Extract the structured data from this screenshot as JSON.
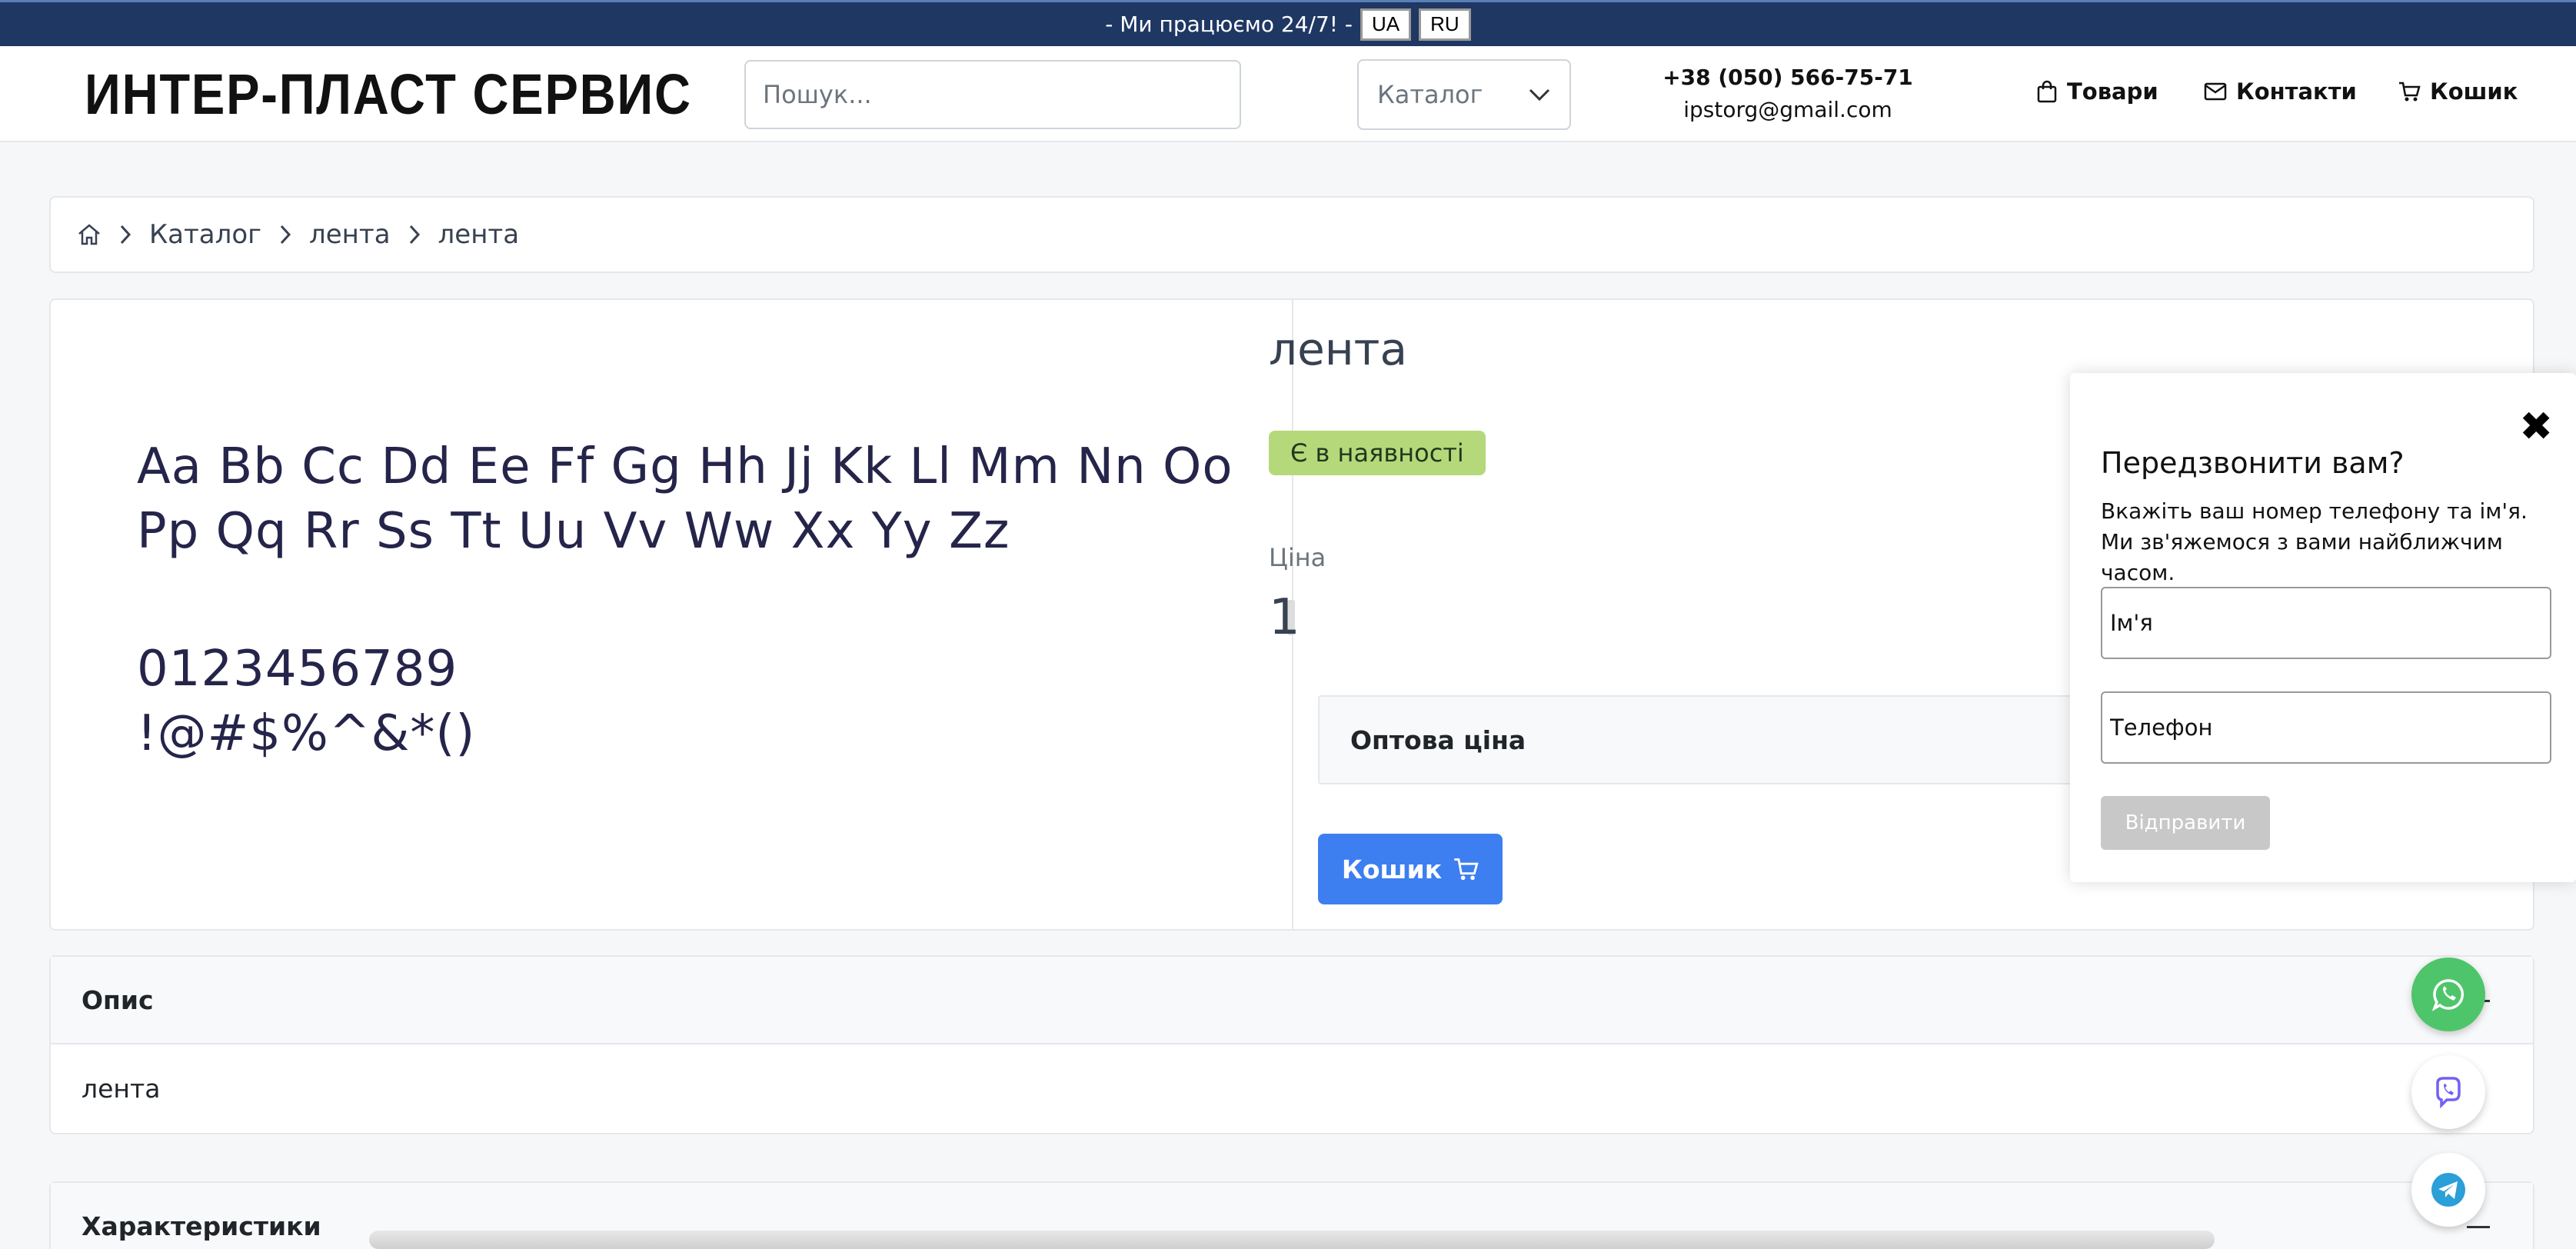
{
  "topbar": {
    "message": "- Ми працюємо 24/7! -",
    "lang_ua": "UA",
    "lang_ru": "RU"
  },
  "header": {
    "logo": "ИНТЕР-ПЛАСТ СЕРВИС",
    "search_placeholder": "Пошук...",
    "catalog_select": "Каталог",
    "phone": "+38 (050) 566-75-71",
    "email": "ipstorg@gmail.com",
    "nav": {
      "products": "Товари",
      "contacts": "Контакти",
      "cart": "Кошик"
    }
  },
  "breadcrumb": {
    "items": [
      "Каталог",
      "лента",
      "лента"
    ]
  },
  "product": {
    "specimen": {
      "line1": "Aa Bb Cc Dd Ee Ff Gg Hh Jj Kk Ll Mm Nn Oo",
      "line2": "Pp Qq Rr Ss Tt Uu Vv Ww Xx Yy Zz",
      "line3": "0123456789",
      "line4": "!@#$%^&*()"
    },
    "title": "лента",
    "stock_badge": "Є в наявності",
    "price_label": "Ціна",
    "price_value": "1",
    "wholesale_label": "Оптова ціна",
    "cart_button": "Кошик"
  },
  "description": {
    "title": "Опис",
    "text": "лента"
  },
  "specs": {
    "title": "Характеристики"
  },
  "callback": {
    "title": "Передзвонити вам?",
    "line1": "Вкажіть ваш номер телефону та ім'я.",
    "line2": "Ми зв'яжемося з вами найближчим часом.",
    "name_placeholder": "Ім'я",
    "phone_placeholder": "Телефон",
    "submit": "Відправити",
    "close_symbol": "✖"
  },
  "colors": {
    "topbar": "#1f3763",
    "accent": "#3d7ff0",
    "badge": "#b5d97a",
    "whatsapp": "#4ec56a"
  }
}
